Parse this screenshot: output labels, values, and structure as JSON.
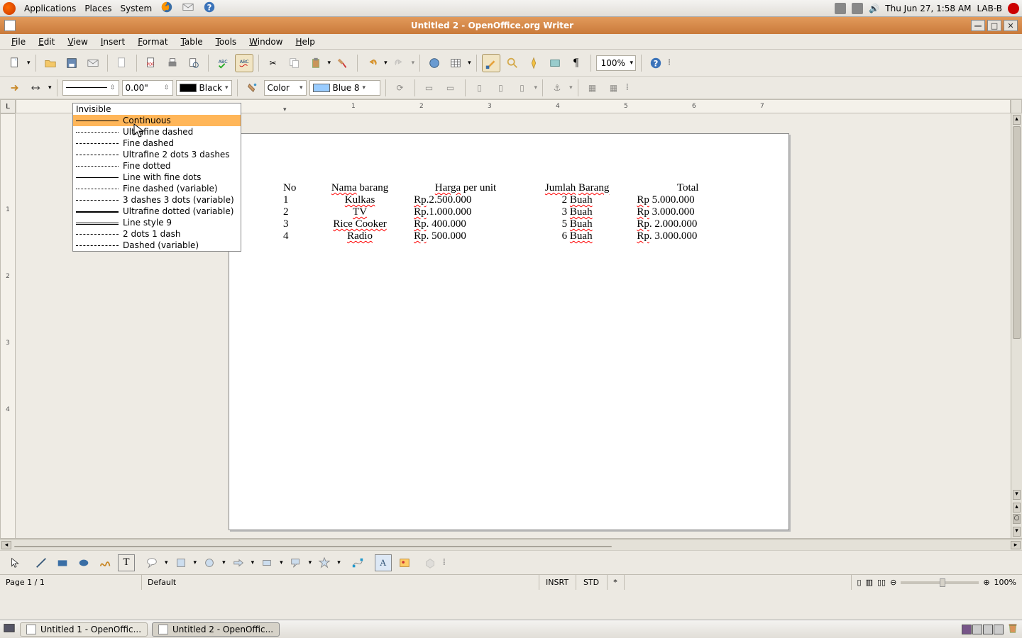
{
  "gnome": {
    "menus": [
      "Applications",
      "Places",
      "System"
    ],
    "clock": "Thu Jun 27,  1:58 AM",
    "session": "LAB-B"
  },
  "window": {
    "title": "Untitled 2 - OpenOffice.org Writer"
  },
  "menubar": {
    "items": [
      "File",
      "Edit",
      "View",
      "Insert",
      "Format",
      "Table",
      "Tools",
      "Window",
      "Help"
    ]
  },
  "toolbar2": {
    "lineWidth": "0.00\"",
    "lineColorLabel": "Black",
    "fillLabel": "Color",
    "fillColorLabel": "Blue 8",
    "zoom": "100%"
  },
  "lineStyleMenu": {
    "header": "Invisible",
    "items": [
      "Continuous",
      "Ultrafine dashed",
      "Fine dashed",
      "Ultrafine 2 dots 3 dashes",
      "Fine dotted",
      "Line with fine dots",
      "Fine dashed (variable)",
      "3 dashes 3 dots (variable)",
      "Ultrafine dotted (variable)",
      "Line style 9",
      "2 dots 1 dash",
      "Dashed (variable)"
    ],
    "highlightIndex": 0
  },
  "ruler": {
    "marks": [
      "1",
      "2",
      "3",
      "4",
      "5",
      "6",
      "7"
    ]
  },
  "vruler": {
    "marks": [
      "1",
      "2",
      "3",
      "4"
    ]
  },
  "docTable": {
    "headers": [
      "No",
      "Nama barang",
      "Harga per unit",
      "Jumlah  Barang",
      "Total"
    ],
    "rows": [
      {
        "no": "1",
        "name": "Kulkas",
        "price": "Rp.2.500.000",
        "qty": "2 Buah",
        "total": "Rp 5.000.000"
      },
      {
        "no": "2",
        "name": "TV",
        "price": "Rp.1.000.000",
        "qty": "3 Buah",
        "total": "Rp 3.000.000"
      },
      {
        "no": "3",
        "name": "Rice Cooker",
        "price": "Rp.   400.000",
        "qty": "5 Buah",
        "total": "Rp. 2.000.000"
      },
      {
        "no": "4",
        "name": "Radio",
        "price": "Rp.   500.000",
        "qty": "6 Buah",
        "total": "Rp. 3.000.000"
      }
    ]
  },
  "statusbar": {
    "page": "Page 1 / 1",
    "style": "Default",
    "insert": "INSRT",
    "sel": "STD",
    "mod": "*",
    "zoom": "100%"
  },
  "taskbar": {
    "items": [
      "Untitled 1 - OpenOffic...",
      "Untitled 2 - OpenOffic..."
    ],
    "activeIndex": 1
  }
}
